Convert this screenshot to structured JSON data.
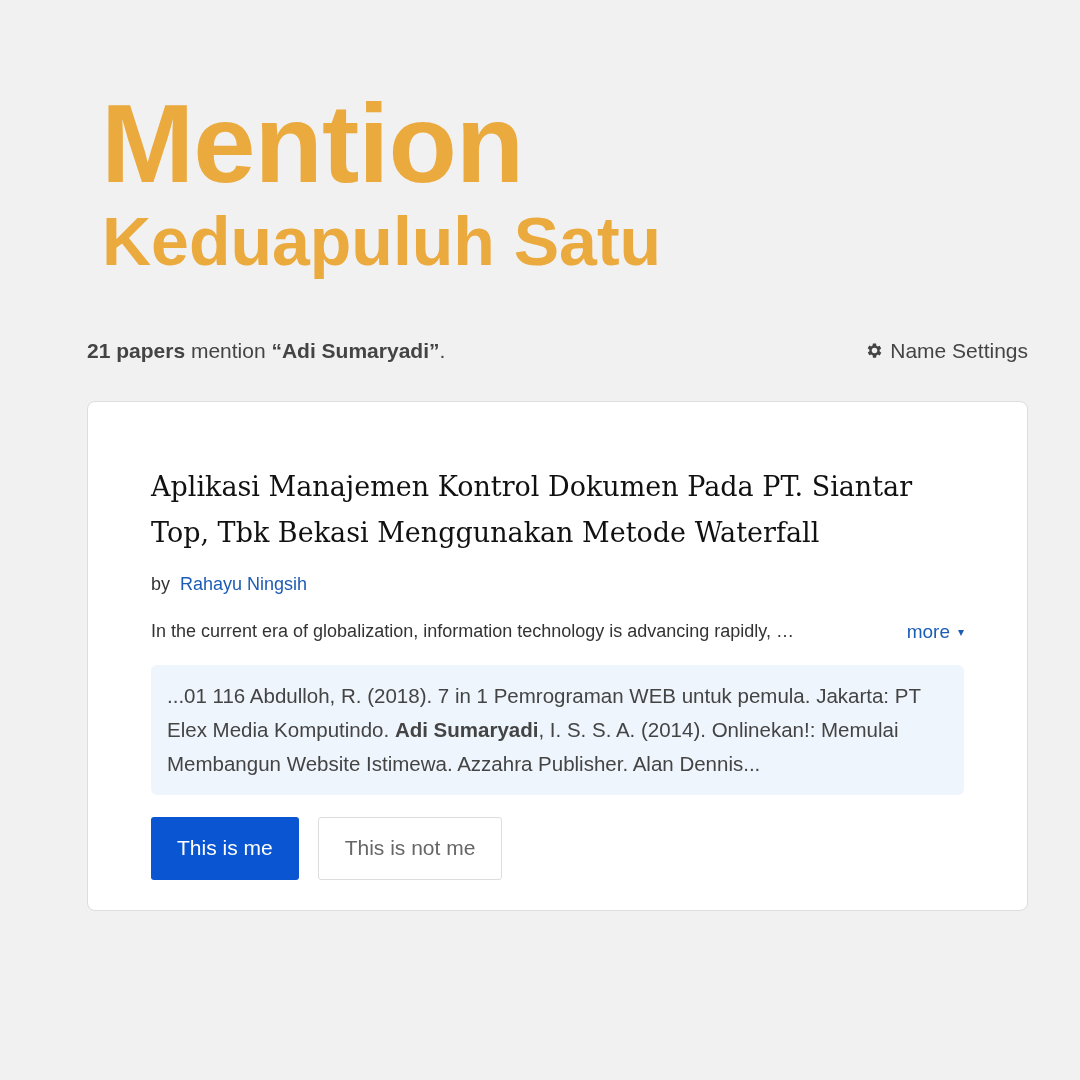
{
  "header": {
    "title": "Mention",
    "subtitle": "Keduapuluh Satu"
  },
  "summary": {
    "text": "**21 papers** mention **“Adi Sumaryadi”**.",
    "settings_link": "Name Settings"
  },
  "paper": {
    "title": "Aplikasi Manajemen Kontrol Dokumen Pada PT. Siantar Top, Tbk Bekasi Menggunakan Metode Waterfall",
    "by_label": "by",
    "author": "Rahayu Ningsih",
    "abstract": "In the current era of globalization, information technology is advancing rapidly, …",
    "more_link": "more",
    "more_caret": "▾",
    "snippet": "...01 116 Abdulloh, R. (2018). 7 in 1 Pemrograman WEB untuk pemula. Jakarta: PT Elex Media Komputindo. **Adi Sumaryadi**, I. S. S. A. (2014). Onlinekan!: Memulai Membangun Website Istimewa. Azzahra Publisher. Alan Dennis...",
    "buttons": [
      {
        "label": "This is me",
        "kind": "primary"
      },
      {
        "label": "This is not me",
        "kind": "secondary"
      }
    ]
  }
}
